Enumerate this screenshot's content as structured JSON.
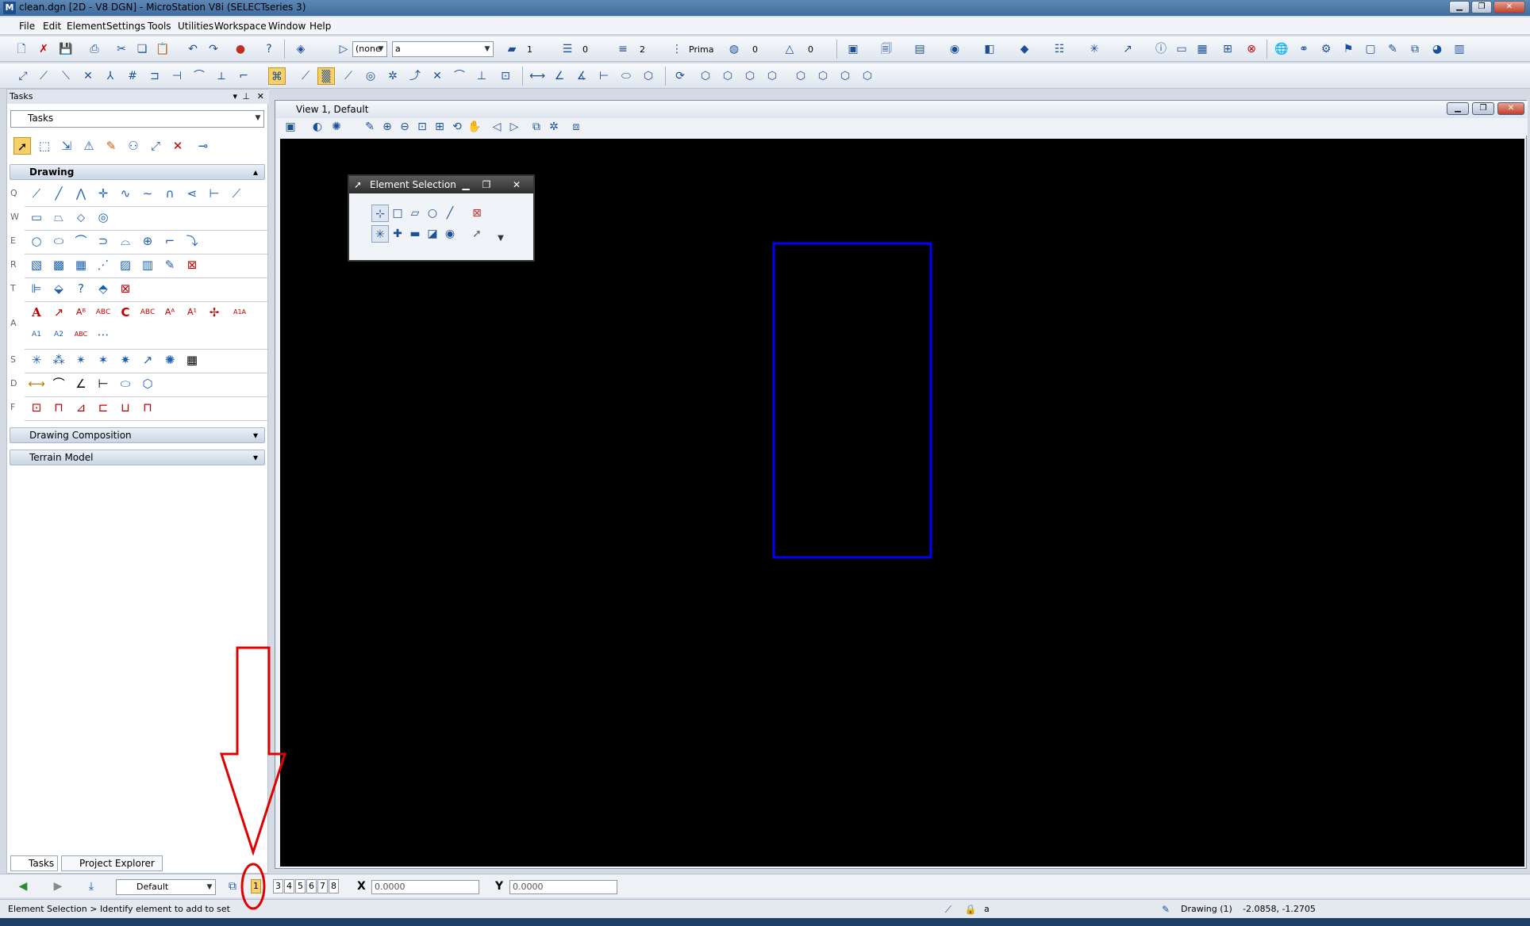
{
  "window": {
    "title": "clean.dgn [2D - V8 DGN] - MicroStation V8i (SELECTseries 3)"
  },
  "menu": [
    "File",
    "Edit",
    "Element",
    "Settings",
    "Tools",
    "Utilities",
    "Workspace",
    "Window",
    "Help"
  ],
  "attributes": {
    "active_level": "(none",
    "level_name": "a",
    "color": "1",
    "line_style": "0",
    "line_weight": "2",
    "class": "Prima",
    "transparency": "0",
    "priority": "0"
  },
  "tasks": {
    "panel_title": "Tasks",
    "dropdown": "Tasks",
    "section_drawing": "Drawing",
    "section_composition": "Drawing Composition",
    "section_terrain": "Terrain Model",
    "row_labels": [
      "Q",
      "W",
      "E",
      "R",
      "T",
      "A",
      "S",
      "D",
      "F"
    ],
    "tab_tasks": "Tasks",
    "tab_project": "Project Explorer"
  },
  "view": {
    "title": "View 1, Default"
  },
  "element_selection": {
    "title": "Element Selection"
  },
  "statusbar": {
    "view_config": "Default",
    "views": [
      "1",
      "3",
      "4",
      "5",
      "6",
      "7",
      "8"
    ],
    "x_label": "X",
    "x_value": "0.0000",
    "y_label": "Y",
    "y_value": "0.0000",
    "prompt": "Element Selection > Identify element to add to set",
    "level": "a",
    "model": "Drawing (1)",
    "coords": "-2.0858, -1.2705"
  },
  "colors": {
    "canvas": "#000000",
    "rectangle": "#0000ff",
    "annotation": "#e00000"
  }
}
